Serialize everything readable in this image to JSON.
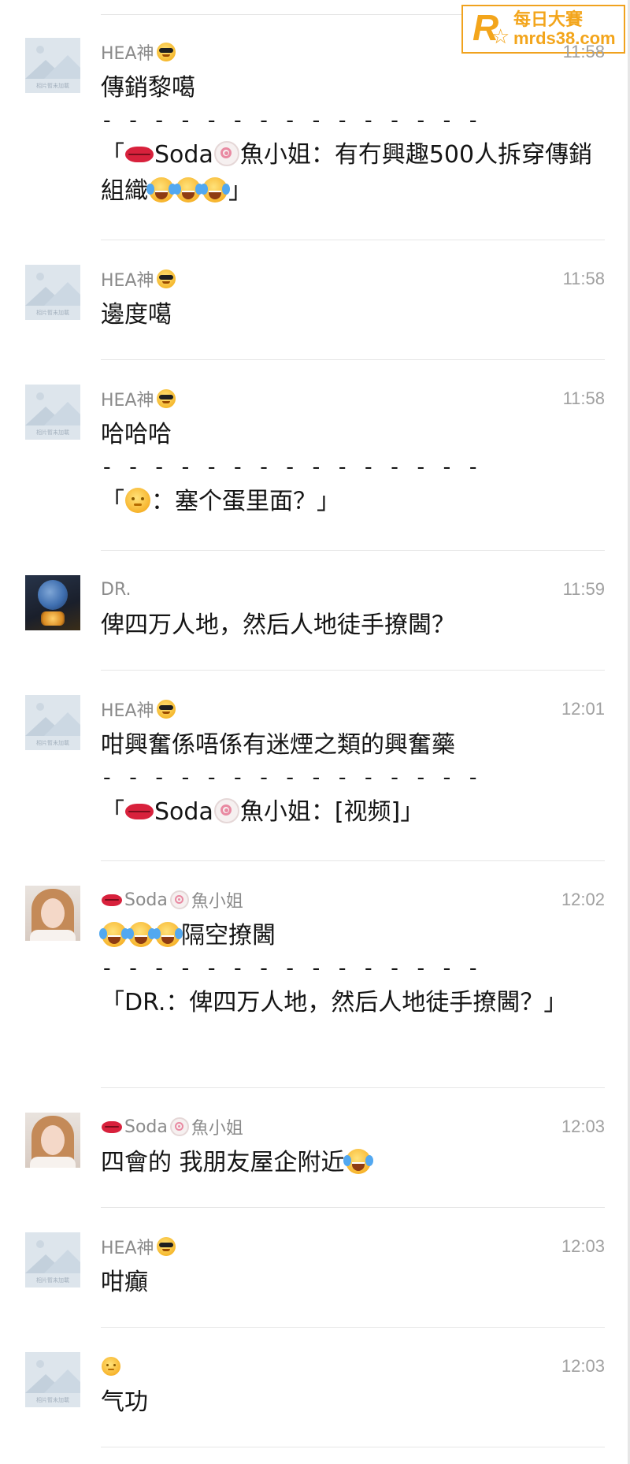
{
  "watermark": {
    "cn": "每日大賽",
    "en": "mrds38.com"
  },
  "avatar_placeholder_caption": "相片暫未加載",
  "messages": [
    {
      "sender": "HEA神",
      "time": "11:58",
      "text": "傳銷黎噶",
      "separator": "- - - - - - - - - - - - - - -",
      "quote_open": "「",
      "quote_name_a": "Soda",
      "quote_name_b": "魚小姐",
      "quote_body": "：有冇興趣500人拆穿傳銷組織",
      "quote_close": "」"
    },
    {
      "sender": "HEA神",
      "time": "11:58",
      "text": "邊度噶"
    },
    {
      "sender": "HEA神",
      "time": "11:58",
      "text": "哈哈哈",
      "separator": "- - - - - - - - - - - - - - -",
      "quote_open": "「",
      "quote_body": "：塞个蛋里面？",
      "quote_close": "」"
    },
    {
      "sender": "DR.",
      "time": "11:59",
      "text": "俾四万人地，然后人地徒手撩閪？"
    },
    {
      "sender": "HEA神",
      "time": "12:01",
      "text": "咁興奮係唔係有迷煙之類的興奮藥",
      "separator": "- - - - - - - - - - - - - - -",
      "quote_open": "「",
      "quote_name_a": "Soda",
      "quote_name_b": "魚小姐",
      "quote_body": "：[视频]",
      "quote_close": "」"
    },
    {
      "sender_a": "Soda",
      "sender_b": "魚小姐",
      "time": "12:02",
      "text": "隔空撩閪",
      "separator": "- - - - - - - - - - - - - - -",
      "quote_text": "「DR.：俾四万人地，然后人地徒手撩閪？」"
    },
    {
      "sender_a": "Soda",
      "sender_b": "魚小姐",
      "time": "12:03",
      "text": "四會的 我朋友屋企附近"
    },
    {
      "sender": "HEA神",
      "time": "12:03",
      "text": "咁癲"
    },
    {
      "time": "12:03",
      "text": "气功"
    }
  ],
  "icons": {
    "sender_emoji": "sunglasses-face-icon",
    "tears_of_joy": "face-with-tears-of-joy-icon",
    "lips": "lips-icon",
    "fishcake": "fish-cake-icon",
    "sun_face": "sun-face-icon"
  }
}
